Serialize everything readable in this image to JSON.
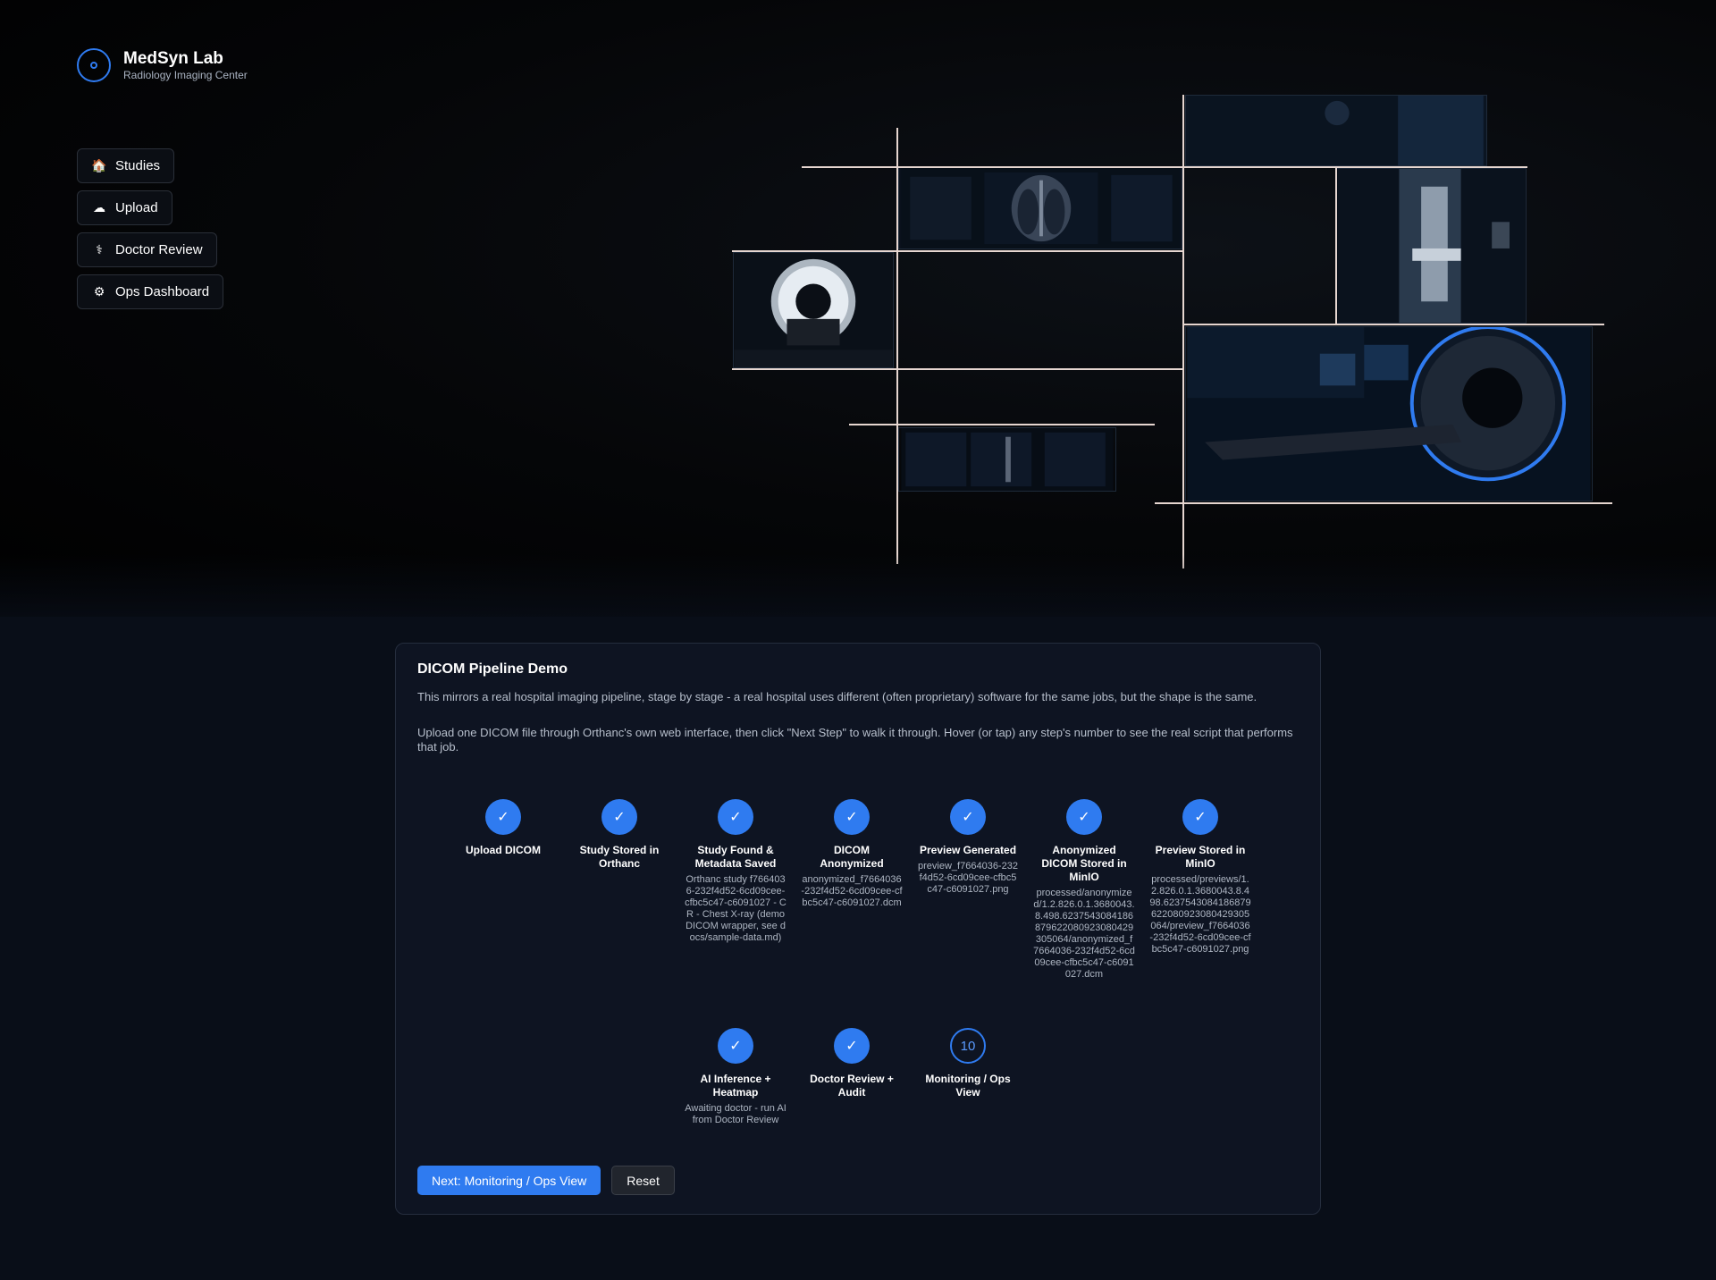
{
  "brand": {
    "name": "MedSyn Lab",
    "subtitle": "Radiology Imaging Center"
  },
  "nav": {
    "studies": {
      "icon": "house-icon",
      "label": "Studies"
    },
    "upload": {
      "icon": "cloud-icon",
      "label": "Upload"
    },
    "doctor_review": {
      "icon": "stethoscope-icon",
      "label": "Doctor Review"
    },
    "ops_dashboard": {
      "icon": "gear-icon",
      "label": "Ops Dashboard"
    }
  },
  "colors": {
    "accent": "#2f7bf0",
    "background": "#000000",
    "panel": "#0e1422"
  },
  "pipeline": {
    "title": "DICOM Pipeline Demo",
    "intro": "This mirrors a real hospital imaging pipeline, stage by stage - a real hospital uses different (often proprietary) software for the same jobs, but the shape is the same.",
    "instructions": "Upload one DICOM file through Orthanc's own web interface, then click \"Next Step\" to walk it through. Hover (or tap) any step's number to see the real script that performs that job.",
    "steps": [
      {
        "mark": "✓",
        "label": "Upload DICOM",
        "detail": ""
      },
      {
        "mark": "✓",
        "label": "Study Stored in Orthanc",
        "detail": ""
      },
      {
        "mark": "✓",
        "label": "Study Found & Metadata Saved",
        "detail": "Orthanc study f7664036-232f4d52-6cd09cee-cfbc5c47-c6091027 - CR - Chest X-ray (demo DICOM wrapper, see docs/sample-data.md)"
      },
      {
        "mark": "✓",
        "label": "DICOM Anonymized",
        "detail": "anonymized_f7664036-232f4d52-6cd09cee-cfbc5c47-c6091027.dcm"
      },
      {
        "mark": "✓",
        "label": "Preview Generated",
        "detail": "preview_f7664036-232f4d52-6cd09cee-cfbc5c47-c6091027.png"
      },
      {
        "mark": "✓",
        "label": "Anonymized DICOM Stored in MinIO",
        "detail": "processed/anonymized/1.2.826.0.1.3680043.8.498.6237543084186879622080923080429305064/anonymized_f7664036-232f4d52-6cd09cee-cfbc5c47-c6091027.dcm"
      },
      {
        "mark": "✓",
        "label": "Preview Stored in MinIO",
        "detail": "processed/previews/1.2.826.0.1.3680043.8.498.6237543084186879622080923080429305064/preview_f7664036-232f4d52-6cd09cee-cfbc5c47-c6091027.png"
      },
      {
        "mark": "✓",
        "label": "AI Inference + Heatmap",
        "detail": "Awaiting doctor - run AI from Doctor Review"
      },
      {
        "mark": "✓",
        "label": "Doctor Review + Audit",
        "detail": ""
      },
      {
        "mark": "10",
        "label": "Monitoring / Ops View",
        "detail": ""
      }
    ],
    "next_button": "Next: Monitoring / Ops View",
    "reset_button": "Reset"
  }
}
